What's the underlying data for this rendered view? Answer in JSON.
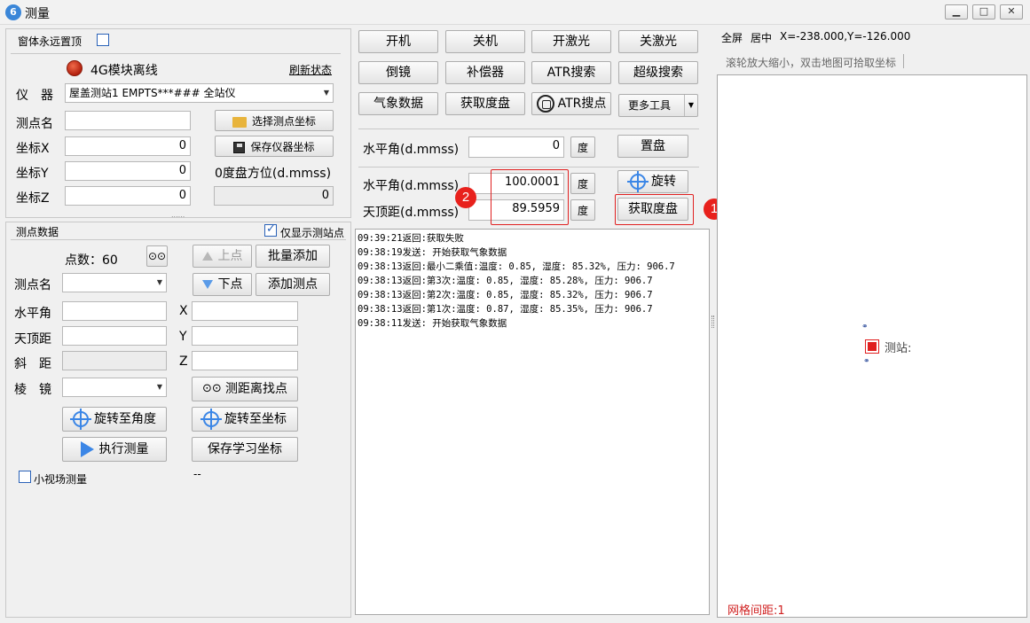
{
  "window": {
    "title": "测量",
    "icon": "app-icon"
  },
  "left": {
    "always_on_top_label": "窗体永远置顶",
    "module_status": "4G模块离线",
    "refresh_status": "刷新状态",
    "instrument_label": "仪　器",
    "instrument_value": "屋盖测站1 EMPTS***### 全站仪",
    "station_name_label": "测点名",
    "choose_station_coord": "选择测点坐标",
    "save_instrument_coord": "保存仪器坐标",
    "coord_x_label": "坐标X",
    "coord_x_value": "0",
    "coord_y_label": "坐标Y",
    "coord_y_value": "0",
    "coord_z_label": "坐标Z",
    "coord_z_value": "0",
    "zero_azimuth_label": "0度盘方位(d.mmss)",
    "zero_azimuth_value": "0",
    "grip": "......",
    "point_data_title": "测点数据",
    "only_station_label": "仅显示测站点",
    "point_count": "点数：60",
    "prev_point": "上点",
    "batch_add": "批量添加",
    "point_name_label": "测点名",
    "next_point": "下点",
    "add_point": "添加测点",
    "h_angle_label": "水平角",
    "x_label": "X",
    "zenith_label": "天顶距",
    "y_label": "Y",
    "slope_label": "斜　距",
    "z_label": "Z",
    "prism_label": "棱　镜",
    "measure_find": "测距离找点",
    "rotate_to_angle": "旋转至角度",
    "rotate_to_coord": "旋转至坐标",
    "execute_measure": "执行测量",
    "save_learn_coord": "保存学习坐标",
    "small_fov_label": "小视场测量",
    "dash_text": "--"
  },
  "middle": {
    "buttons_row1": [
      "开机",
      "关机",
      "开激光",
      "关激光"
    ],
    "buttons_row2": [
      "倒镜",
      "补偿器",
      "ATR搜索",
      "超级搜索"
    ],
    "weather_data": "气象数据",
    "get_dial": "获取度盘",
    "atr_point": "ATR搜点",
    "more_tools": "更多工具",
    "set_h_label": "水平角(d.mmss)",
    "set_h_value": "0",
    "deg1": "度",
    "set_dial": "置盘",
    "read_h_label": "水平角(d.mmss)",
    "read_h_value": "100.0001",
    "deg2": "度",
    "rotate": "旋转",
    "read_v_label": "天顶距(d.mmss)",
    "read_v_value": "89.5959",
    "deg3": "度",
    "get_dial2": "获取度盘",
    "badge1": "1",
    "badge2": "2",
    "log": [
      "09:39:21返回:获取失败",
      "09:38:19发送: 开始获取气象数据",
      "09:38:13返回:最小二乘值:温度: 0.85, 湿度: 85.32%, 压力: 906.7",
      "09:38:13返回:第3次:温度: 0.85, 湿度: 85.28%, 压力: 906.7",
      "09:38:13返回:第2次:温度: 0.85, 湿度: 85.32%, 压力: 906.7",
      "09:38:13返回:第1次:温度: 0.87, 湿度: 85.35%, 压力: 906.7",
      "09:38:11发送: 开始获取气象数据"
    ]
  },
  "right": {
    "fullscreen": "全屏",
    "center": "居中",
    "coords": "X=-238.000,Y=-126.000",
    "hint": "滚轮放大缩小，双击地图可拾取坐标",
    "station_label": "测站:",
    "grid_spacing": "网格间距:1"
  },
  "colors": {
    "accent": "#3b86e6",
    "highlight": "#e02020",
    "badge": "#e8211c",
    "grid_text": "#d02020"
  }
}
